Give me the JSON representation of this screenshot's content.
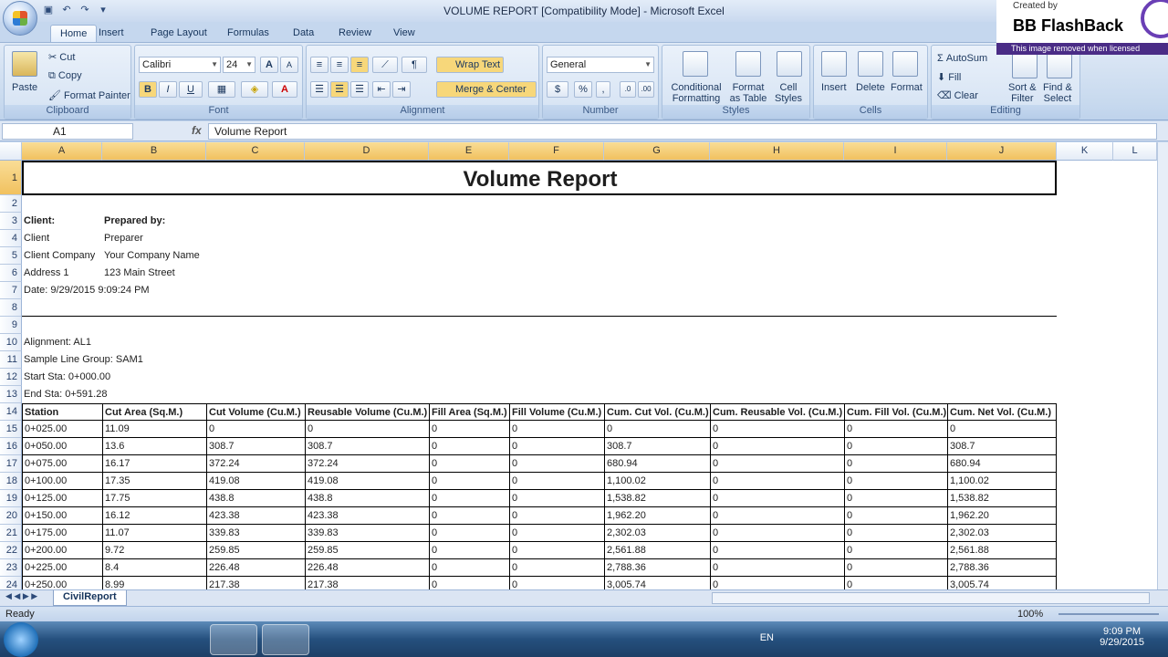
{
  "window": {
    "title": "VOLUME REPORT  [Compatibility Mode] - Microsoft Excel"
  },
  "tabs": [
    "Home",
    "Insert",
    "Page Layout",
    "Formulas",
    "Data",
    "Review",
    "View"
  ],
  "ribbon": {
    "clipboard": {
      "paste": "Paste",
      "cut": "Cut",
      "copy": "Copy",
      "format_painter": "Format Painter",
      "label": "Clipboard"
    },
    "font": {
      "name": "Calibri",
      "size": "24",
      "label": "Font"
    },
    "alignment": {
      "wrap": "Wrap Text",
      "merge": "Merge & Center",
      "label": "Alignment"
    },
    "number": {
      "format": "General",
      "currency": "$",
      "percent": "%",
      "comma": ",",
      "label": "Number"
    },
    "styles": {
      "conditional": "Conditional",
      "conditional2": "Formatting",
      "format_table": "Format",
      "format_table2": "as Table",
      "cell_styles": "Cell",
      "cell_styles2": "Styles",
      "label": "Styles"
    },
    "cells": {
      "insert": "Insert",
      "delete": "Delete",
      "format": "Format",
      "label": "Cells"
    },
    "editing": {
      "autosum": "AutoSum",
      "fill": "Fill",
      "clear": "Clear",
      "sort": "Sort &",
      "sort2": "Filter",
      "find": "Find &",
      "find2": "Select",
      "label": "Editing"
    }
  },
  "watermark": {
    "created": "Created by",
    "brand": "BB FlashBack",
    "removed": "This image removed when licensed"
  },
  "formula": {
    "name_box": "A1",
    "fx": "fx",
    "content": "Volume Report"
  },
  "columns": [
    "A",
    "B",
    "C",
    "D",
    "E",
    "F",
    "G",
    "H",
    "I",
    "J",
    "K",
    "L"
  ],
  "rows": [
    "1",
    "2",
    "3",
    "4",
    "5",
    "6",
    "7",
    "8",
    "9",
    "10",
    "11",
    "12",
    "13",
    "14",
    "15",
    "16",
    "17",
    "18",
    "19",
    "20",
    "21",
    "22",
    "23",
    "24"
  ],
  "report": {
    "title": "Volume Report",
    "client_label": "Client:",
    "prepared_label": "Prepared by:",
    "client": "Client",
    "preparer": "Preparer",
    "client_company": "Client Company",
    "company_name": "Your Company Name",
    "address": "Address 1",
    "street": "123 Main Street",
    "date": "Date: 9/29/2015 9:09:24 PM",
    "alignment": "Alignment: AL1",
    "sample_group": "Sample Line Group: SAM1",
    "start_sta": "Start Sta: 0+000.00",
    "end_sta": "End Sta: 0+591.28"
  },
  "table": {
    "headers": [
      "Station",
      "Cut Area (Sq.M.)",
      "Cut Volume (Cu.M.)",
      "Reusable Volume (Cu.M.)",
      "Fill Area (Sq.M.)",
      "Fill Volume (Cu.M.)",
      "Cum. Cut Vol. (Cu.M.)",
      "Cum. Reusable Vol. (Cu.M.)",
      "Cum. Fill Vol. (Cu.M.)",
      "Cum. Net Vol. (Cu.M.)"
    ],
    "rows": [
      [
        "0+025.00",
        "11.09",
        "0",
        "0",
        "0",
        "0",
        "0",
        "0",
        "0",
        "0"
      ],
      [
        "0+050.00",
        "13.6",
        "308.7",
        "308.7",
        "0",
        "0",
        "308.7",
        "0",
        "0",
        "308.7"
      ],
      [
        "0+075.00",
        "16.17",
        "372.24",
        "372.24",
        "0",
        "0",
        "680.94",
        "0",
        "0",
        "680.94"
      ],
      [
        "0+100.00",
        "17.35",
        "419.08",
        "419.08",
        "0",
        "0",
        "1,100.02",
        "0",
        "0",
        "1,100.02"
      ],
      [
        "0+125.00",
        "17.75",
        "438.8",
        "438.8",
        "0",
        "0",
        "1,538.82",
        "0",
        "0",
        "1,538.82"
      ],
      [
        "0+150.00",
        "16.12",
        "423.38",
        "423.38",
        "0",
        "0",
        "1,962.20",
        "0",
        "0",
        "1,962.20"
      ],
      [
        "0+175.00",
        "11.07",
        "339.83",
        "339.83",
        "0",
        "0",
        "2,302.03",
        "0",
        "0",
        "2,302.03"
      ],
      [
        "0+200.00",
        "9.72",
        "259.85",
        "259.85",
        "0",
        "0",
        "2,561.88",
        "0",
        "0",
        "2,561.88"
      ],
      [
        "0+225.00",
        "8.4",
        "226.48",
        "226.48",
        "0",
        "0",
        "2,788.36",
        "0",
        "0",
        "2,788.36"
      ],
      [
        "0+250.00",
        "8.99",
        "217.38",
        "217.38",
        "0",
        "0",
        "3,005.74",
        "0",
        "0",
        "3,005.74"
      ]
    ]
  },
  "sheet": {
    "tab": "CivilReport"
  },
  "status": {
    "ready": "Ready",
    "zoom": "100%"
  },
  "tray": {
    "lang": "EN",
    "time": "9:09 PM",
    "date": "9/29/2015"
  }
}
